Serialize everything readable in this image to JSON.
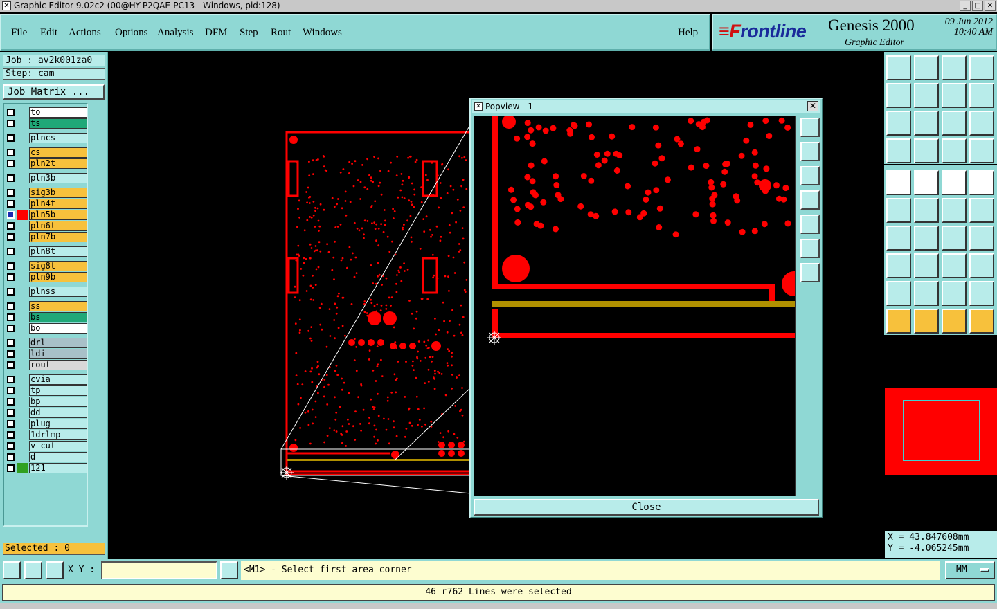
{
  "window": {
    "title": "Graphic Editor 9.02c2 (00@HY-P2QAE-PC13 - Windows, pid:128)",
    "min": "_",
    "max": "□",
    "close": "✕"
  },
  "menu": {
    "items": [
      "File",
      "Edit",
      "Actions",
      "Options",
      "Analysis",
      "DFM",
      "Step",
      "Rout",
      "Windows"
    ],
    "help": "Help"
  },
  "brand": {
    "logo_f": "≡F",
    "logo_rest": "rontline",
    "product": "Genesis 2000",
    "subtitle": "Graphic Editor",
    "date": "09 Jun 2012",
    "time": "10:40 AM"
  },
  "job": {
    "job": "Job : av2k001za0",
    "step": "Step: cam",
    "matrix_button": "Job Matrix ..."
  },
  "layers": [
    {
      "name": "to",
      "color": "#ffffff",
      "mark": "⇐"
    },
    {
      "name": "ts",
      "color": "#20a878",
      "mark": ""
    },
    {
      "name": "plncs",
      "color": "#b8ecea",
      "mark": ""
    },
    {
      "name": "cs",
      "color": "#f7c13c",
      "mark": "⇐"
    },
    {
      "name": "pln2t",
      "color": "#f7c13c",
      "mark": "⇐"
    },
    {
      "name": "pln3b",
      "color": "#b8ecea",
      "mark": ""
    },
    {
      "name": "sig3b",
      "color": "#f7c13c",
      "mark": "⇐"
    },
    {
      "name": "pln4t",
      "color": "#f7c13c",
      "mark": "⇐"
    },
    {
      "name": "pln5b",
      "color": "#f7c13c",
      "mark": "⇐▤",
      "active": true
    },
    {
      "name": "pln6t",
      "color": "#f7c13c",
      "mark": "⇐"
    },
    {
      "name": "pln7b",
      "color": "#f7c13c",
      "mark": "⇐"
    },
    {
      "name": "pln8t",
      "color": "#b8ecea",
      "mark": ""
    },
    {
      "name": "sig8t",
      "color": "#f7c13c",
      "mark": "⇐"
    },
    {
      "name": "pln9b",
      "color": "#f7c13c",
      "mark": "⇐"
    },
    {
      "name": "plnss",
      "color": "#b8ecea",
      "mark": ""
    },
    {
      "name": "ss",
      "color": "#f7c13c",
      "mark": "⇐"
    },
    {
      "name": "bs",
      "color": "#20a878",
      "mark": ""
    },
    {
      "name": "bo",
      "color": "#ffffff",
      "mark": "⇐"
    },
    {
      "name": "drl",
      "color": "#a8c0c8",
      "mark": ""
    },
    {
      "name": "ldi",
      "color": "#a8c0c8",
      "mark": ""
    },
    {
      "name": "rout",
      "color": "#d8d8d8",
      "mark": ""
    },
    {
      "name": "cvia",
      "color": "#b8ecea",
      "mark": ""
    },
    {
      "name": "tp",
      "color": "#b8ecea",
      "mark": ""
    },
    {
      "name": "bp",
      "color": "#b8ecea",
      "mark": ""
    },
    {
      "name": "dd",
      "color": "#b8ecea",
      "mark": "⇐"
    },
    {
      "name": "plug",
      "color": "#b8ecea",
      "mark": ""
    },
    {
      "name": "1drlmp",
      "color": "#b8ecea",
      "mark": ""
    },
    {
      "name": "v-cut",
      "color": "#b8ecea",
      "mark": ""
    },
    {
      "name": "d",
      "color": "#b8ecea",
      "mark": ""
    },
    {
      "name": "121",
      "color": "#b8ecea",
      "mark": "",
      "swatch": "#30a020"
    }
  ],
  "selected": "Selected : 0",
  "popview": {
    "title": "Popview - 1",
    "close_x": "✕",
    "close_button": "Close"
  },
  "coords": {
    "x": "X = 43.847608mm",
    "y": "Y = -4.065245mm"
  },
  "cmd": {
    "xy_label": "X Y :",
    "xy_value": "",
    "prompt": "<M1> - Select first area corner",
    "units": "MM"
  },
  "status": "46 r762 Lines were selected",
  "colors": {
    "panel": "#8fd8d4",
    "feature": "#ff0000",
    "highlight": "#b09000"
  }
}
